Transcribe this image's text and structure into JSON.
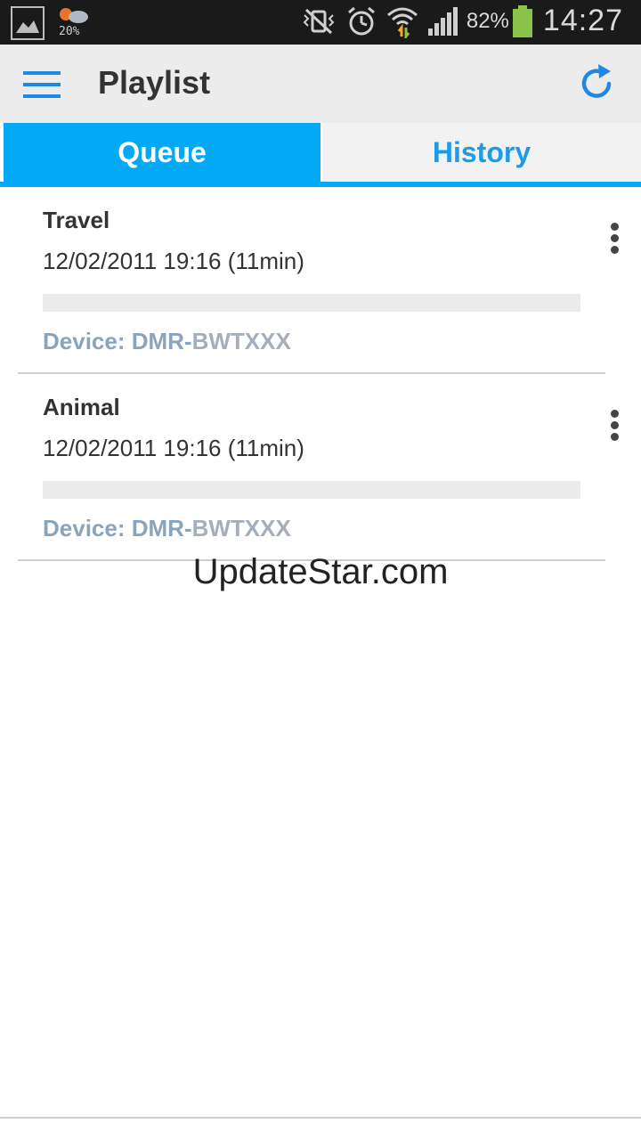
{
  "status_bar": {
    "weather_pct": "20%",
    "battery_pct": "82%",
    "time": "14:27",
    "icons": [
      "gallery-icon",
      "weather-icon",
      "mute-vibrate-icon",
      "alarm-icon",
      "wifi-icon",
      "signal-icon",
      "battery-icon"
    ],
    "battery_level": 0.82
  },
  "app_bar": {
    "title": "Playlist",
    "accent": "#1e88e5"
  },
  "tabs": [
    {
      "label": "Queue",
      "selected": true
    },
    {
      "label": "History",
      "selected": false
    }
  ],
  "items": [
    {
      "title": "Travel",
      "time": "12/02/2011 19:16 (11min)",
      "device_prefix": "Device: DMR-",
      "device_model": "BWTXXX",
      "progress": 0
    },
    {
      "title": "Animal",
      "time": "12/02/2011 19:16 (11min)",
      "device_prefix": "Device: DMR-",
      "device_model": "BWTXXX",
      "progress": 0
    }
  ],
  "watermark": "UpdateStar.com",
  "colors": {
    "tab_active_bg": "#03a9f4",
    "tab_inactive_text": "#1e9be8",
    "device_text": "#8aa4be"
  }
}
